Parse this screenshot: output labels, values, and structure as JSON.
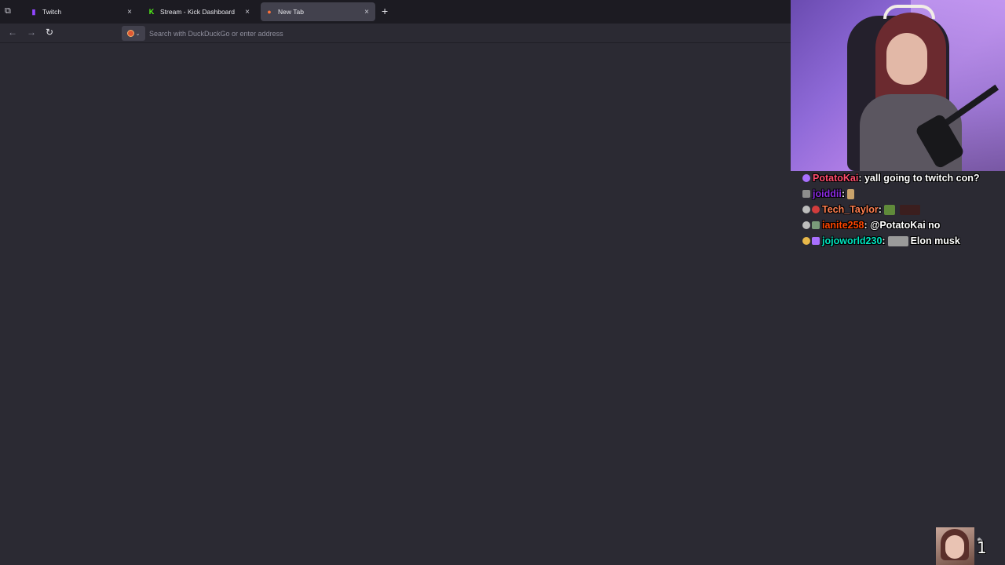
{
  "browser": {
    "tabs": [
      {
        "label": "Twitch",
        "favicon": "twitch-icon",
        "color": "#9146ff",
        "active": false
      },
      {
        "label": "Stream - Kick Dashboard",
        "favicon": "kick-icon",
        "color": "#53fc18",
        "active": false
      },
      {
        "label": "New Tab",
        "favicon": "firefox-icon",
        "color": "#ff7139",
        "active": true
      }
    ],
    "close_glyph": "×",
    "new_tab_glyph": "+",
    "tabs_list_glyph": "⧉",
    "nav": {
      "back_glyph": "←",
      "forward_glyph": "→",
      "reload_glyph": "↻"
    },
    "search": {
      "placeholder": "Search with DuckDuckGo or enter address",
      "engine_icon": "duckduckgo-icon"
    },
    "background_color": "#2b2a33"
  },
  "chat": {
    "messages": [
      {
        "user": "PotatoKai",
        "user_color": "#ff4d6d",
        "text": "yall going to twitch con?",
        "emote": false
      },
      {
        "user": "joiddii",
        "user_color": "#8a2be2",
        "text": "",
        "emote": "small"
      },
      {
        "user": "Tech_Taylor",
        "user_color": "#ff7f50",
        "text": "",
        "emote": "wide"
      },
      {
        "user": "ianite258",
        "user_color": "#ff4500",
        "text": "@PotatoKai no",
        "emote": false
      },
      {
        "user": "jojoworld230",
        "user_color": "#00e5c0",
        "text": "Elon musk",
        "emote": "wide"
      }
    ]
  },
  "overlay": {
    "viewer_count": "1"
  }
}
